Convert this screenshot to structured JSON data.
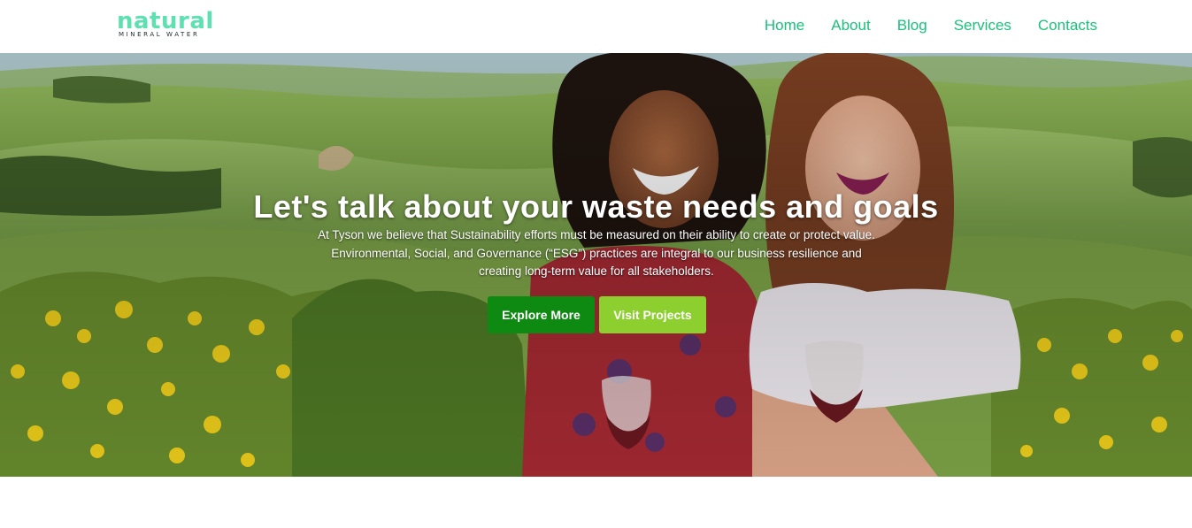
{
  "brand": {
    "name": "natural",
    "tagline": "MINERAL WATER",
    "color": "#5fe0b0"
  },
  "nav": {
    "items": [
      {
        "label": "Home"
      },
      {
        "label": "About"
      },
      {
        "label": "Blog"
      },
      {
        "label": "Services"
      },
      {
        "label": "Contacts"
      }
    ],
    "color": "#19c27a"
  },
  "hero": {
    "title": "Let's talk about your waste needs and goals",
    "line1": "At Tyson we believe that Sustainability efforts must be measured on their ability to create or protect value.",
    "line2": "Environmental, Social, and Governance (“ESG”) practices are integral to our business resilience and",
    "line3": "creating long-term value for all stakeholders.",
    "primary_button": "Explore More",
    "secondary_button": "Visit Projects",
    "primary_color": "#0e8a12",
    "secondary_color": "#8ccf2e"
  }
}
